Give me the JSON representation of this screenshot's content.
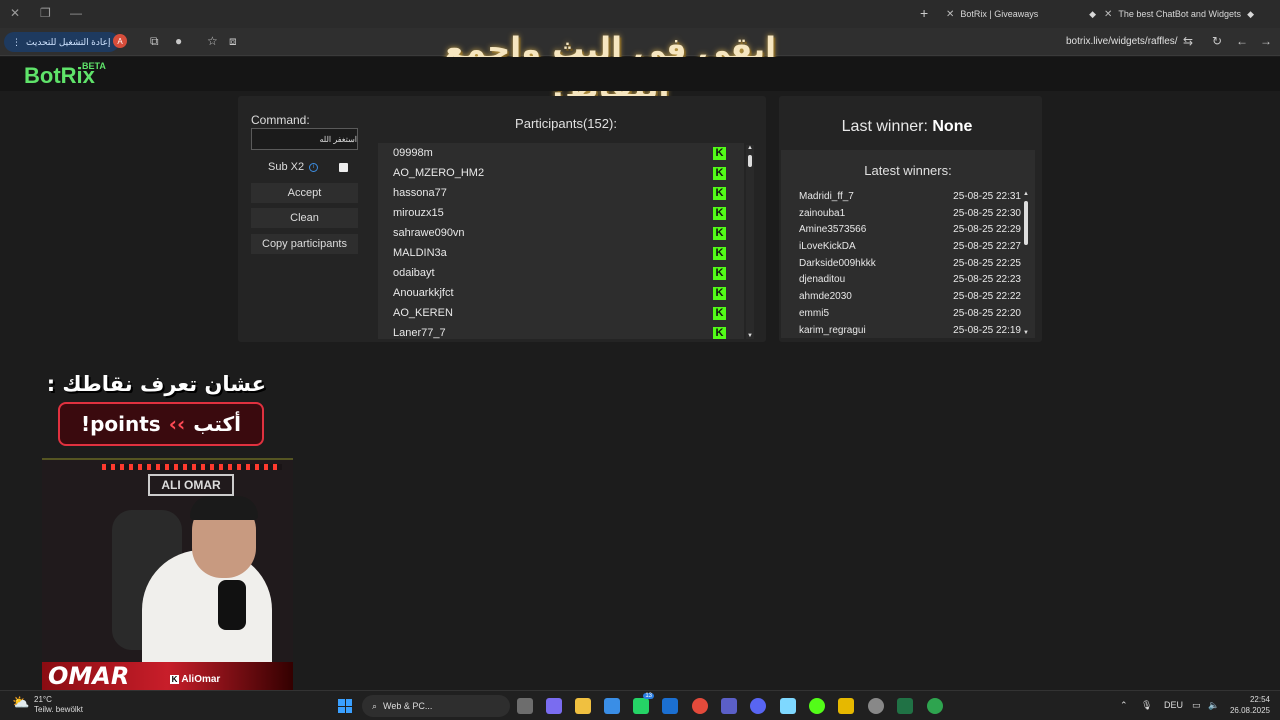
{
  "browser": {
    "tabs": [
      {
        "title": "BotRix | Giveaways"
      },
      {
        "title": "The best ChatBot and Widgets"
      }
    ],
    "restart_label": "إعادة التشغيل للتحديث",
    "profile_initial": "A",
    "url": "botrix.live/widgets/raffles/"
  },
  "overlay": {
    "banner": "ابقى في البث واجمع النقاط!",
    "points_hint": "عشان تعرف نقاطك :",
    "points_cmd_word": "أكتب",
    "points_cmd": "!points",
    "streamer_logo": "OMAR",
    "streamer_handle": "AliOmar",
    "sign": "ALI OMAR"
  },
  "site": {
    "brand": "BotRix",
    "beta": "BETA"
  },
  "controls": {
    "command_label": "Command:",
    "command_value": "استغفر الله",
    "sub_x2_label": "Sub X2",
    "sub_x2_checked": false,
    "accept_label": "Accept",
    "clean_label": "Clean",
    "copy_label": "Copy participants"
  },
  "participants": {
    "title": "Participants(152):",
    "platform_icon": "kick-icon",
    "accent": "#53fc18",
    "items": [
      "09998m",
      "AO_MZERO_HM2",
      "hassona77",
      "mirouzx15",
      "sahrawe090vn",
      "MALDIN3a",
      "odaibayt",
      "Anouarkkjfct",
      "AO_KEREN",
      "Laner77_7"
    ]
  },
  "winners": {
    "last_winner_label": "Last winner:",
    "last_winner_value": "None",
    "latest_title": "Latest winners:",
    "items": [
      {
        "name": "Madridi_ff_7",
        "time": "25-08-25 22:31"
      },
      {
        "name": "zainouba1",
        "time": "25-08-25 22:30"
      },
      {
        "name": "Amine3573566",
        "time": "25-08-25 22:29"
      },
      {
        "name": "iLoveKickDA",
        "time": "25-08-25 22:27"
      },
      {
        "name": "Darkside009hkkk",
        "time": "25-08-25 22:25"
      },
      {
        "name": "djenaditou",
        "time": "25-08-25 22:23"
      },
      {
        "name": "ahmde2030",
        "time": "25-08-25 22:22"
      },
      {
        "name": "emmi5",
        "time": "25-08-25 22:20"
      },
      {
        "name": "karim_regragui",
        "time": "25-08-25 22:19"
      }
    ]
  },
  "taskbar": {
    "temp": "21°C",
    "weather": "Teilw. bewölkt",
    "search": "Web & PC...",
    "lang": "DEU",
    "time": "22:54",
    "date": "26.08.2025",
    "badge_whatsapp": "13"
  }
}
